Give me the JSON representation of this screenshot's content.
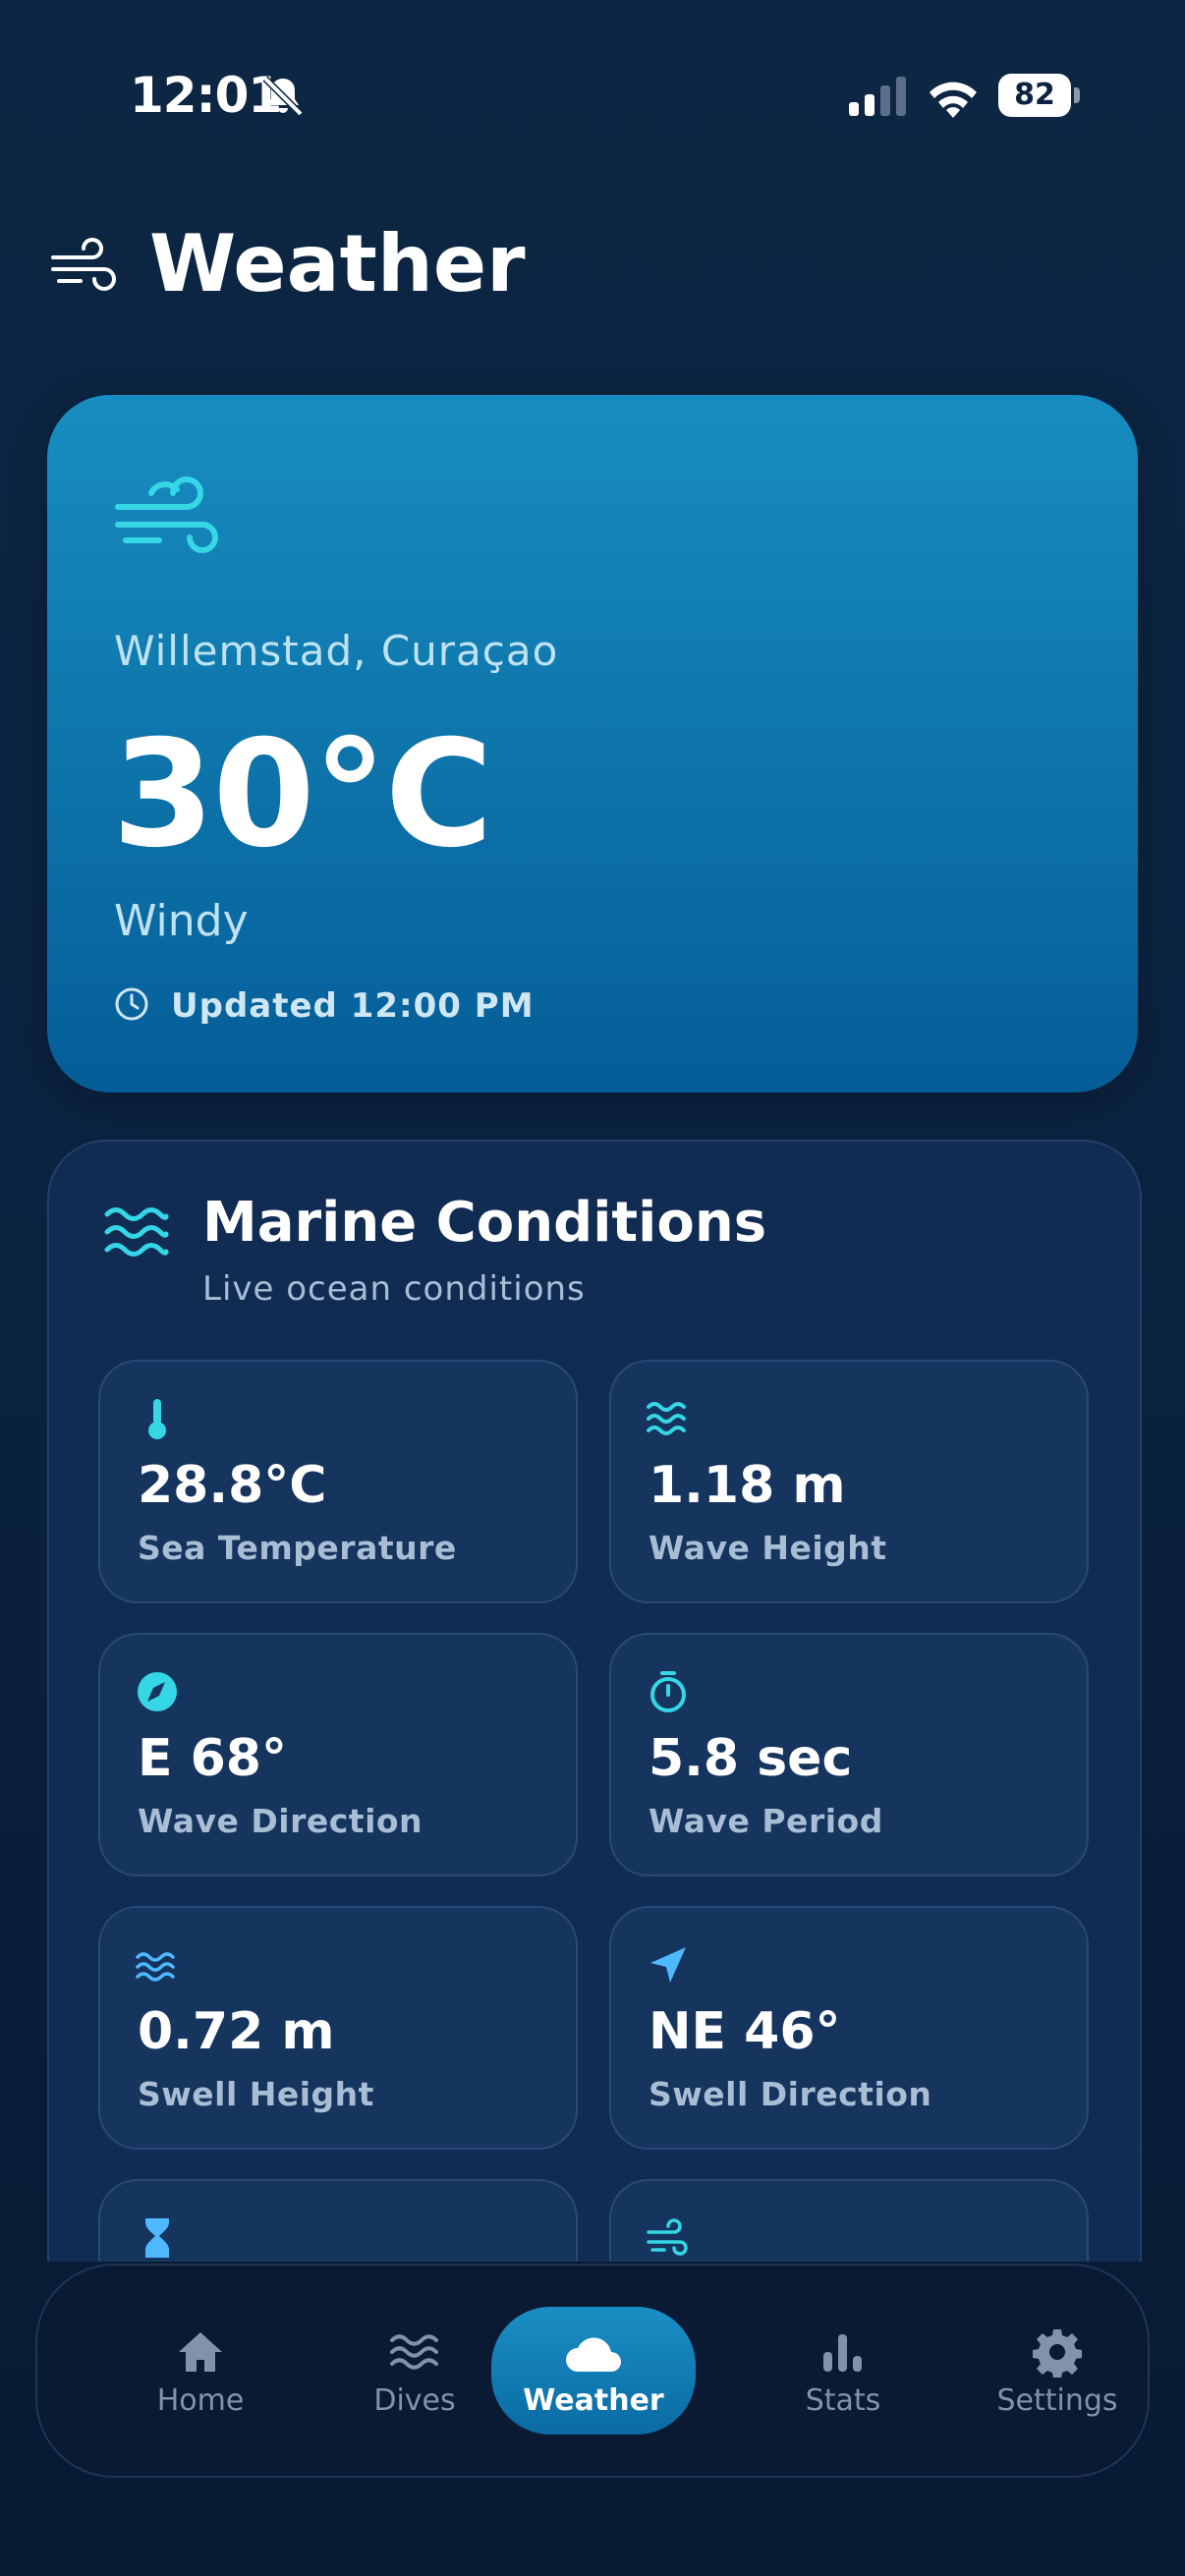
{
  "status_bar": {
    "time": "12:01",
    "battery": "82"
  },
  "header": {
    "title": "Weather"
  },
  "hero": {
    "location": "Willemstad, Curaçao",
    "temperature": "30°C",
    "condition": "Windy",
    "updated": "Updated 12:00 PM"
  },
  "marine": {
    "title": "Marine Conditions",
    "subtitle": "Live ocean conditions",
    "tiles": [
      {
        "value": "28.8°C",
        "label": "Sea Temperature",
        "icon": "thermometer-icon"
      },
      {
        "value": "1.18 m",
        "label": "Wave Height",
        "icon": "waves-icon"
      },
      {
        "value": "E 68°",
        "label": "Wave Direction",
        "icon": "compass-icon"
      },
      {
        "value": "5.8 sec",
        "label": "Wave Period",
        "icon": "timer-icon"
      },
      {
        "value": "0.72 m",
        "label": "Swell Height",
        "icon": "swell-icon"
      },
      {
        "value": "NE 46°",
        "label": "Swell Direction",
        "icon": "navigation-arrow-icon"
      },
      {
        "value": "",
        "label": "",
        "icon": "hourglass-icon"
      },
      {
        "value": "",
        "label": "",
        "icon": "wind-icon"
      }
    ]
  },
  "nav": {
    "items": [
      {
        "label": "Home",
        "icon": "home-icon"
      },
      {
        "label": "Dives",
        "icon": "waves-icon"
      },
      {
        "label": "Weather",
        "icon": "cloud-icon",
        "active": true
      },
      {
        "label": "Stats",
        "icon": "bar-chart-icon"
      },
      {
        "label": "Settings",
        "icon": "gear-icon"
      }
    ]
  },
  "colors": {
    "accent": "#35d6e6",
    "hero_top": "#178dc1",
    "hero_bottom": "#055d98",
    "background": "#0c2643"
  }
}
